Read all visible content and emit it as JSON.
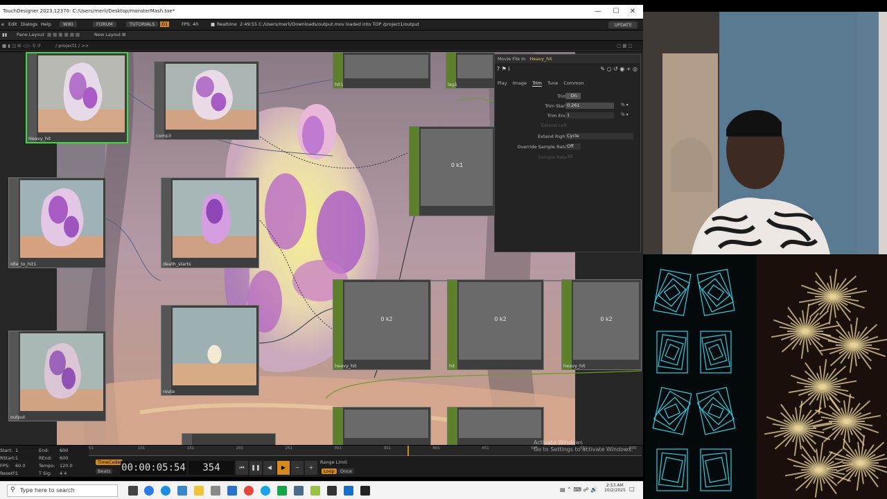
{
  "window": {
    "title": "TouchDesigner 2023.12370: C:/Users/merli/Desktop/monsterMash.toe*",
    "controls": [
      "—",
      "☐",
      "✕"
    ]
  },
  "menubar": {
    "items": [
      "e",
      "Edit",
      "Dialogs",
      "Help"
    ],
    "wiki": "WIKI",
    "forum": "FORUM",
    "tutorials": "TUTORIALS",
    "badge": "D1",
    "fps": "FPS: 40",
    "realtime": "Realtime",
    "status": "2:49:55 C:/Users/merli/Downloads/output.mov loaded into TOP /project1/output",
    "update": "UPDATE"
  },
  "panebar": {
    "pane_layout": "Pane Layout",
    "new_layout": "New Layout"
  },
  "pathbar": {
    "path": "/ project1 / >>"
  },
  "nodes": {
    "heavy_hit_top": "Heavy_hit",
    "comp3": "comp3",
    "idle_to_hit1": "idle_to_hit1",
    "death_starts": "death_starts",
    "output": "output",
    "route": "route",
    "hit1": "hit1",
    "lag1": "lag1",
    "heavy_hit2": "heavy_hit",
    "hit2": "hit",
    "heavy_hit3": "heavy_hit",
    "val_ok1": "0 k1",
    "val_ok2a": "0 k2",
    "val_ok2b": "0 k2",
    "val_ok2c": "0 k2"
  },
  "params": {
    "type": "Movie File In",
    "name": "Heavy_hit",
    "tabs": [
      "Play",
      "Image",
      "Trim",
      "Tune",
      "Common"
    ],
    "active_tab": "Trim",
    "rows": [
      {
        "label": "Trim",
        "value": "On"
      },
      {
        "label": "Trim Start",
        "value": "0.261"
      },
      {
        "label": "Trim End",
        "value": "1"
      },
      {
        "label": "Extend Left",
        "value": ""
      },
      {
        "label": "Extend Right",
        "value": "Cycle"
      },
      {
        "label": "Override Sample Rate",
        "value": "Off"
      },
      {
        "label": "Sample Rate",
        "value": "30"
      }
    ]
  },
  "timeline": {
    "start_label": "Start:",
    "start": "1",
    "end_label": "End:",
    "end": "600",
    "rstart_label": "RStart:",
    "rstart": "1",
    "rend_label": "REnd:",
    "rend": "600",
    "fps_label": "FPS:",
    "fps": "60.0",
    "tempo_label": "Tempo:",
    "tempo": "120.0",
    "resetf_label": "ResetF:",
    "resetf": "1",
    "tsig_label": "T Sig:",
    "tsig": "4   4",
    "timecode_btn": "TimeCode",
    "beats_btn": "Beats",
    "timecode": "00:00:05:54",
    "frame": "354",
    "range_limit": "Range Limit",
    "loop": "Loop",
    "once": "Once",
    "ruler": [
      "51",
      "101",
      "151",
      "201",
      "251",
      "301",
      "351",
      "401",
      "451",
      "501",
      "551",
      "600"
    ]
  },
  "watermark": {
    "line1": "Activate Windows",
    "line2": "Go to Settings to activate Windows."
  },
  "taskbar": {
    "search": "Type here to search",
    "time": "2:53 AM",
    "date": "10/2/2025"
  },
  "colors": {
    "chop_green": "#5e7f2c",
    "selection": "#3ddc3d",
    "accent_orange": "#d48a1e",
    "viz_cyan": "#2fd3e6",
    "viz_gold": "#e8d398"
  }
}
